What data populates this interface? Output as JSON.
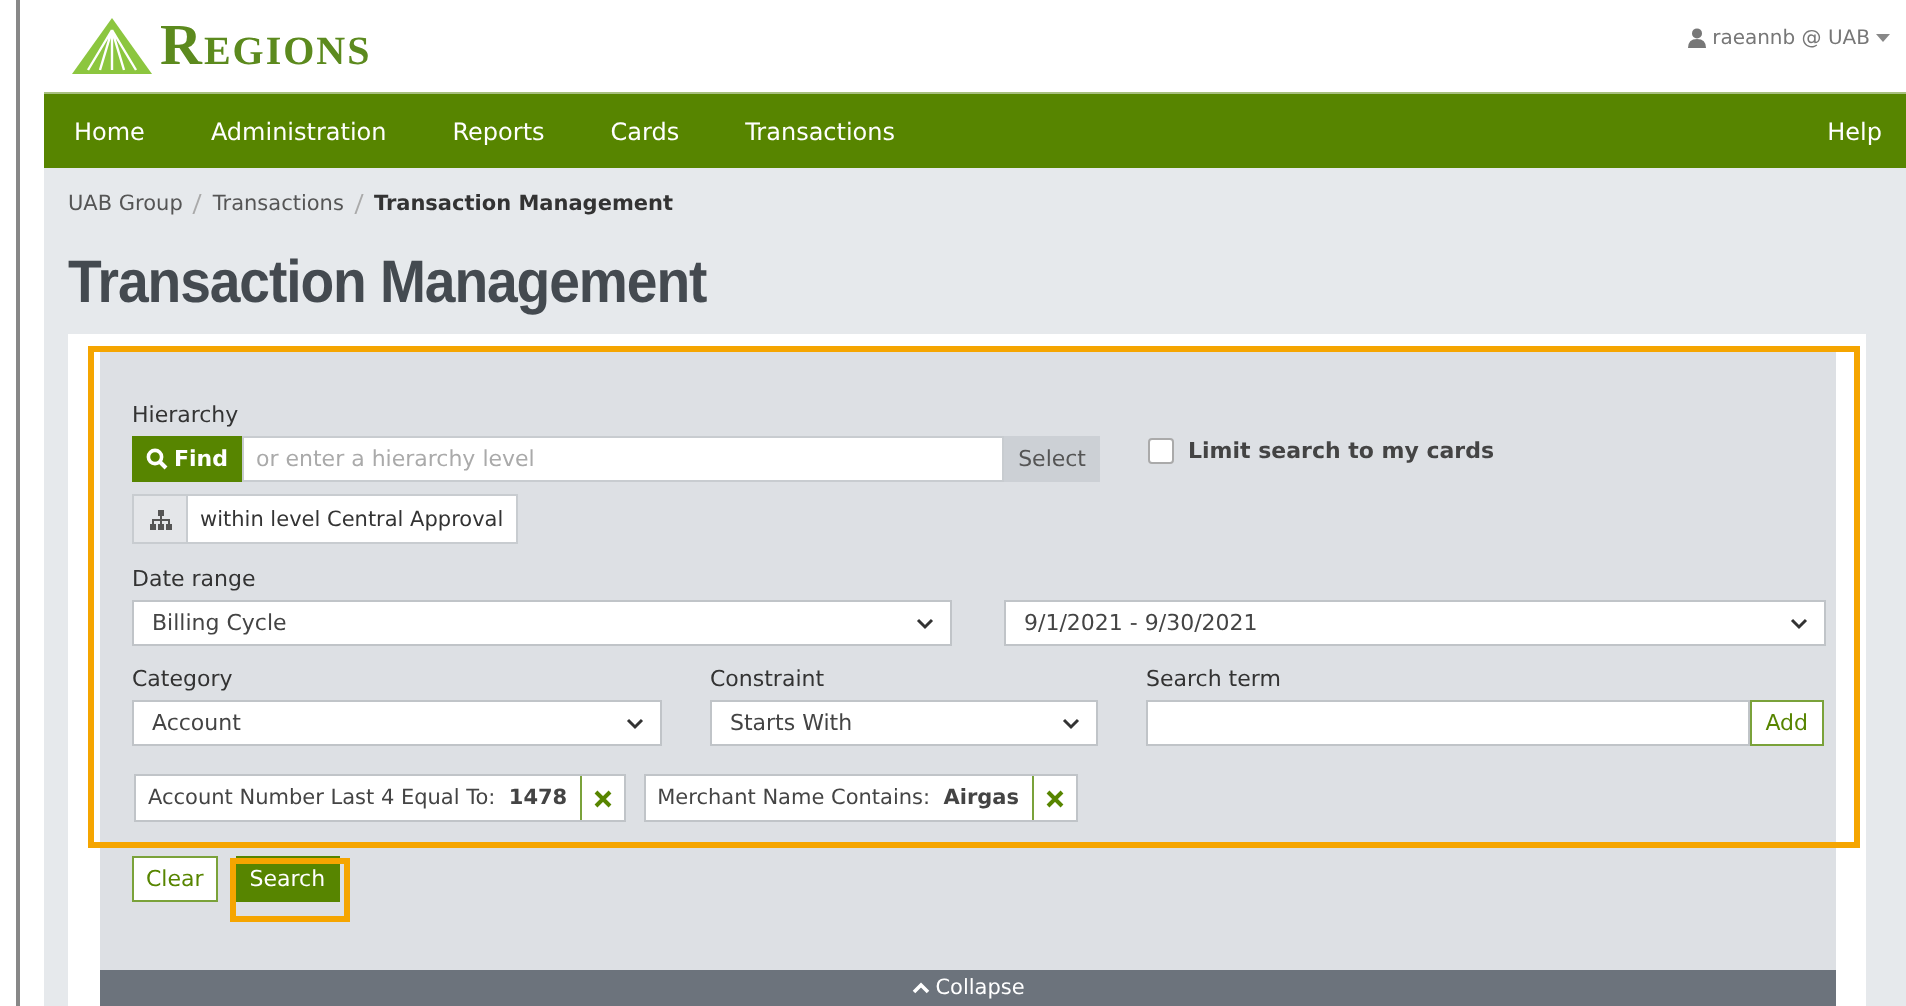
{
  "header": {
    "logo": "Regions",
    "user": "raeannb @ UAB"
  },
  "nav": {
    "items": [
      "Home",
      "Administration",
      "Reports",
      "Cards",
      "Transactions"
    ],
    "help": "Help"
  },
  "breadcrumb": [
    "UAB Group",
    "Transactions",
    "Transaction Management"
  ],
  "title": "Transaction Management",
  "form": {
    "hierarchy": {
      "label": "Hierarchy",
      "find": "Find",
      "placeholder": "or enter a hierarchy level",
      "select": "Select",
      "level": "within level Central Approval"
    },
    "limit": {
      "label": "Limit search to my cards",
      "checked": false
    },
    "date_range": {
      "label": "Date range",
      "type": "Billing Cycle",
      "range": "9/1/2021 - 9/30/2021"
    },
    "category": {
      "label": "Category",
      "value": "Account"
    },
    "constraint": {
      "label": "Constraint",
      "value": "Starts With"
    },
    "search_term": {
      "label": "Search term",
      "add": "Add"
    },
    "filters": [
      "Account Number Last 4 Equal To:  **1478**",
      "Merchant Name Contains:  **Airgas**"
    ],
    "buttons": {
      "clear": "Clear",
      "search": "Search"
    },
    "collapse": "Collapse"
  }
}
